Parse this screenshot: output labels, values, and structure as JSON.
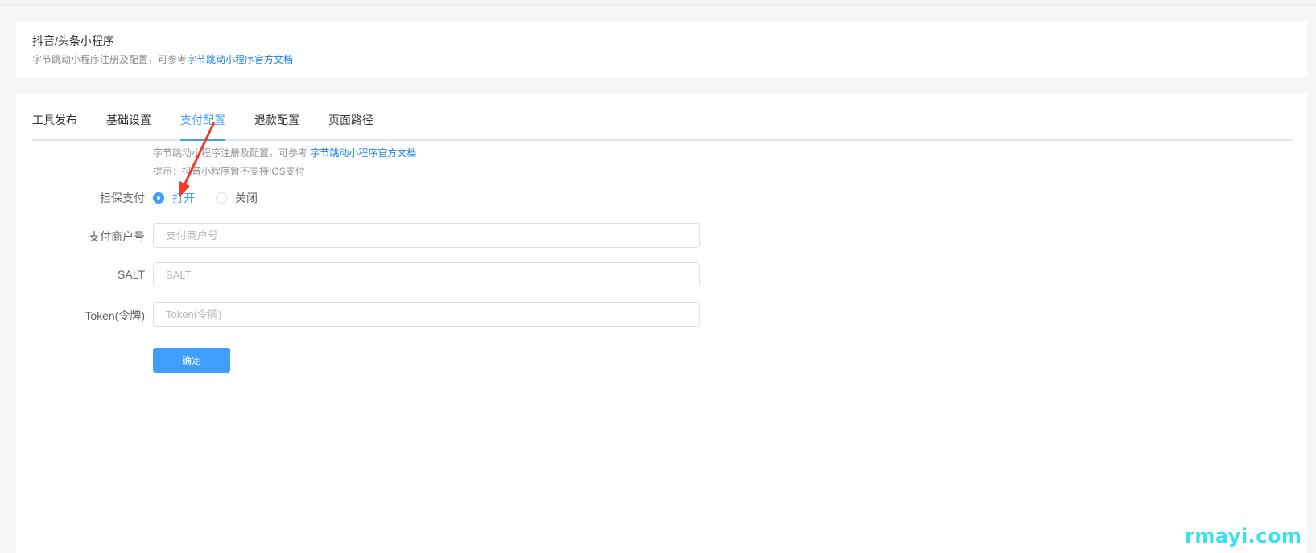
{
  "header": {
    "title": "抖音/头条小程序",
    "subtitle_prefix": "字节跳动小程序注册及配置，可参考",
    "subtitle_link": "字节跳动小程序官方文档"
  },
  "tabs": [
    {
      "label": "工具发布",
      "active": false
    },
    {
      "label": "基础设置",
      "active": false
    },
    {
      "label": "支付配置",
      "active": true
    },
    {
      "label": "退款配置",
      "active": false
    },
    {
      "label": "页面路径",
      "active": false
    }
  ],
  "form": {
    "hint1_prefix": "字节跳动小程序注册及配置，可参考",
    "hint1_link": "字节跳动小程序官方文档",
    "hint2": "提示：抖音小程序暂不支持IOS支付",
    "guarantee_pay": {
      "label": "担保支付",
      "options": [
        {
          "label": "打开",
          "checked": true
        },
        {
          "label": "关闭",
          "checked": false
        }
      ]
    },
    "merchant_id": {
      "label": "支付商户号",
      "placeholder": "支付商户号",
      "value": ""
    },
    "salt": {
      "label": "SALT",
      "placeholder": "SALT",
      "value": ""
    },
    "token": {
      "label": "Token(令牌)",
      "placeholder": "Token(令牌)",
      "value": ""
    },
    "submit_label": "确定"
  },
  "watermark": "rmayi.com",
  "colors": {
    "accent": "#409eff",
    "link": "#1c7fe8",
    "annotation_arrow": "#f03a2e",
    "watermark": "#3be0f0"
  }
}
